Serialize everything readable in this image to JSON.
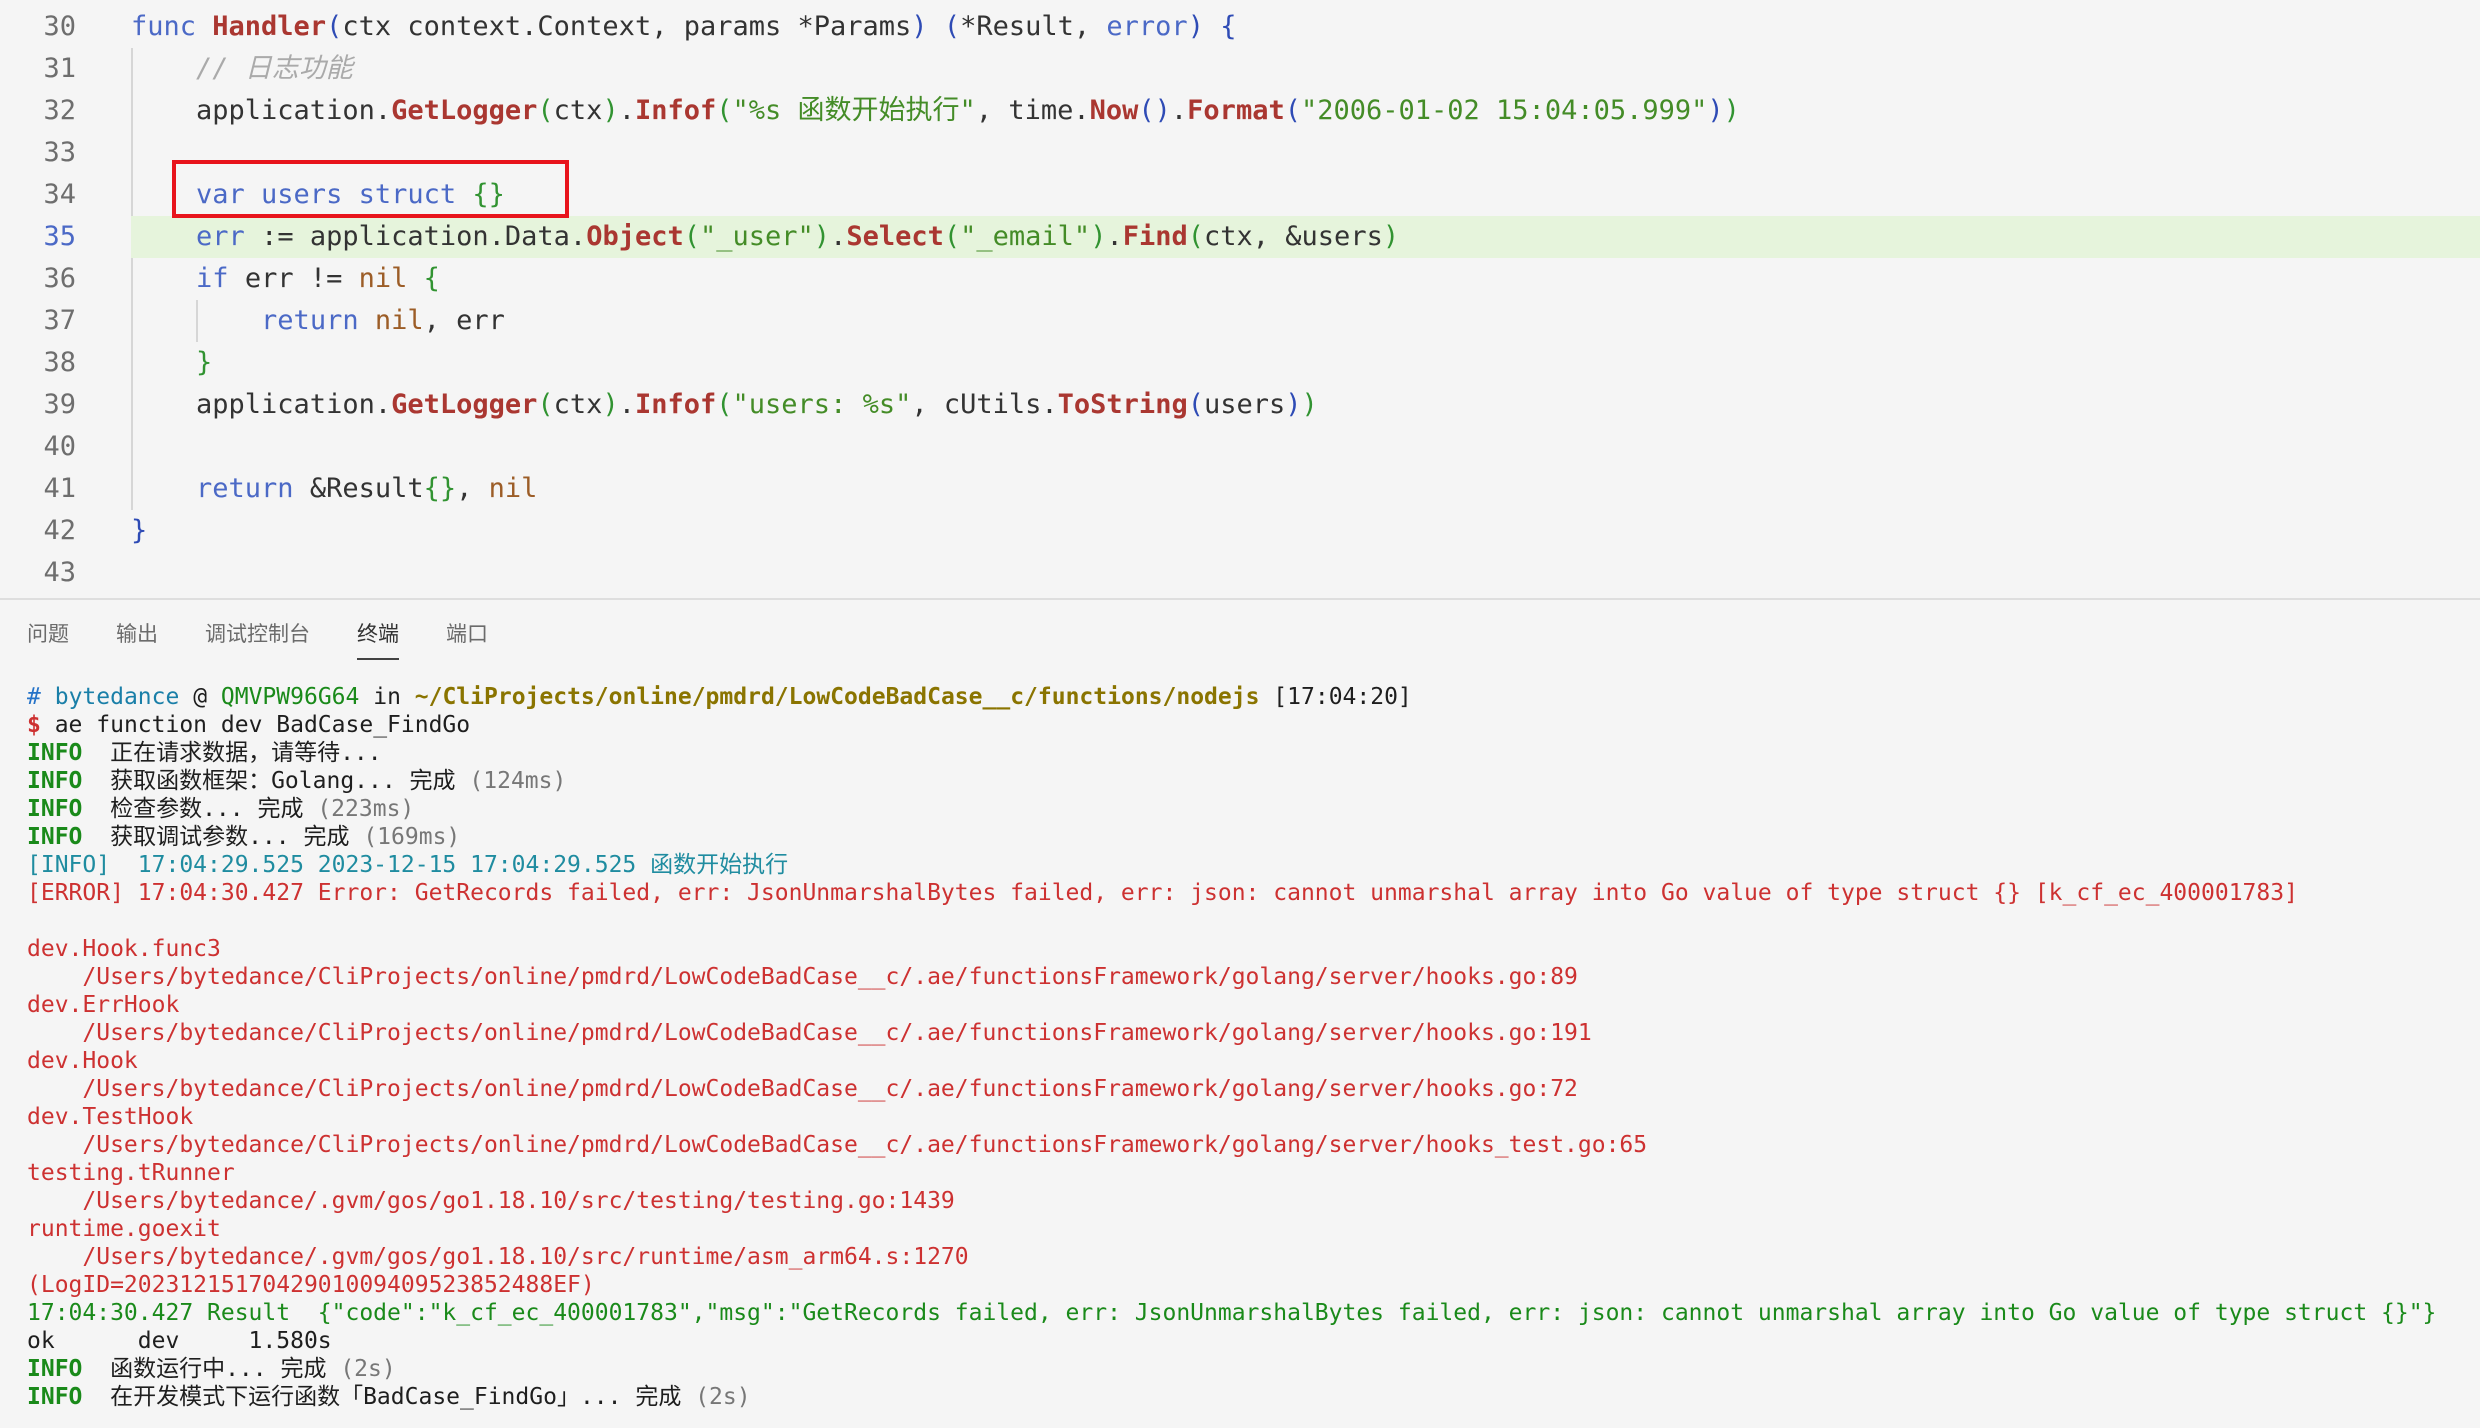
{
  "colors": {
    "background": "#f5f5f5",
    "current_line_bg": "#e6f4dc",
    "highlight_box": "#e8141c",
    "prompt_marker": "#1a85ff"
  },
  "editor": {
    "current_line": 35,
    "lines": [
      {
        "number": 30,
        "tokens": [
          {
            "t": "func ",
            "c": "#4b69c6"
          },
          {
            "t": "Handler",
            "c": "#aa3731"
          },
          {
            "t": "(",
            "c": "#2e4bb5"
          },
          {
            "t": "ctx context.Context, params *Params",
            "c": "#333333"
          },
          {
            "t": ")",
            "c": "#2e4bb5"
          },
          {
            "t": " ",
            "c": "#333333"
          },
          {
            "t": "(",
            "c": "#2e4bb5"
          },
          {
            "t": "*Result, ",
            "c": "#333333"
          },
          {
            "t": "error",
            "c": "#4b69c6"
          },
          {
            "t": ")",
            "c": "#2e4bb5"
          },
          {
            "t": " ",
            "c": "#333333"
          },
          {
            "t": "{",
            "c": "#2e4bb5"
          }
        ]
      },
      {
        "number": 31,
        "tokens": [
          {
            "t": "    // 日志功能",
            "c": "#aaaaaa"
          }
        ]
      },
      {
        "number": 32,
        "tokens": [
          {
            "t": "    application.",
            "c": "#333333"
          },
          {
            "t": "GetLogger",
            "c": "#aa3731"
          },
          {
            "t": "(",
            "c": "#319331"
          },
          {
            "t": "ctx",
            "c": "#333333"
          },
          {
            "t": ")",
            "c": "#319331"
          },
          {
            "t": ".",
            "c": "#333333"
          },
          {
            "t": "Infof",
            "c": "#aa3731"
          },
          {
            "t": "(",
            "c": "#319331"
          },
          {
            "t": "\"%s 函数开始执行\"",
            "c": "#448c27"
          },
          {
            "t": ", time.",
            "c": "#333333"
          },
          {
            "t": "Now",
            "c": "#aa3731"
          },
          {
            "t": "()",
            "c": "#2e4bb5"
          },
          {
            "t": ".",
            "c": "#333333"
          },
          {
            "t": "Format",
            "c": "#aa3731"
          },
          {
            "t": "(",
            "c": "#2e4bb5"
          },
          {
            "t": "\"2006-01-02 15:04:05.999\"",
            "c": "#448c27"
          },
          {
            "t": ")",
            "c": "#2e4bb5"
          },
          {
            "t": ")",
            "c": "#319331"
          }
        ]
      },
      {
        "number": 33,
        "tokens": []
      },
      {
        "number": 34,
        "tokens": [
          {
            "t": "    var users struct ",
            "c": "#4b69c6"
          },
          {
            "t": "{}",
            "c": "#319331"
          }
        ]
      },
      {
        "number": 35,
        "tokens": [
          {
            "t": "    ",
            "c": "#333333"
          },
          {
            "t": "err",
            "c": "#4b69c6"
          },
          {
            "t": " := application.Data.",
            "c": "#333333"
          },
          {
            "t": "Object",
            "c": "#aa3731"
          },
          {
            "t": "(",
            "c": "#319331"
          },
          {
            "t": "\"_user\"",
            "c": "#448c27"
          },
          {
            "t": ")",
            "c": "#319331"
          },
          {
            "t": ".",
            "c": "#333333"
          },
          {
            "t": "Select",
            "c": "#aa3731"
          },
          {
            "t": "(",
            "c": "#319331"
          },
          {
            "t": "\"_email\"",
            "c": "#448c27"
          },
          {
            "t": ")",
            "c": "#319331"
          },
          {
            "t": ".",
            "c": "#333333"
          },
          {
            "t": "Find",
            "c": "#aa3731"
          },
          {
            "t": "(",
            "c": "#319331"
          },
          {
            "t": "ctx, &users",
            "c": "#333333"
          },
          {
            "t": ")",
            "c": "#319331"
          }
        ]
      },
      {
        "number": 36,
        "tokens": [
          {
            "t": "    ",
            "c": "#333333"
          },
          {
            "t": "if ",
            "c": "#4b69c6"
          },
          {
            "t": "err != ",
            "c": "#333333"
          },
          {
            "t": "nil ",
            "c": "#9c5d27"
          },
          {
            "t": "{",
            "c": "#319331"
          }
        ]
      },
      {
        "number": 37,
        "tokens": [
          {
            "t": "        ",
            "c": "#333333"
          },
          {
            "t": "return ",
            "c": "#4b69c6"
          },
          {
            "t": "nil",
            "c": "#9c5d27"
          },
          {
            "t": ", err",
            "c": "#333333"
          }
        ]
      },
      {
        "number": 38,
        "tokens": [
          {
            "t": "    ",
            "c": "#333333"
          },
          {
            "t": "}",
            "c": "#319331"
          }
        ]
      },
      {
        "number": 39,
        "tokens": [
          {
            "t": "    application.",
            "c": "#333333"
          },
          {
            "t": "GetLogger",
            "c": "#aa3731"
          },
          {
            "t": "(",
            "c": "#319331"
          },
          {
            "t": "ctx",
            "c": "#333333"
          },
          {
            "t": ")",
            "c": "#319331"
          },
          {
            "t": ".",
            "c": "#333333"
          },
          {
            "t": "Infof",
            "c": "#aa3731"
          },
          {
            "t": "(",
            "c": "#319331"
          },
          {
            "t": "\"users: %s\"",
            "c": "#448c27"
          },
          {
            "t": ", cUtils.",
            "c": "#333333"
          },
          {
            "t": "ToString",
            "c": "#aa3731"
          },
          {
            "t": "(",
            "c": "#2e4bb5"
          },
          {
            "t": "users",
            "c": "#333333"
          },
          {
            "t": ")",
            "c": "#2e4bb5"
          },
          {
            "t": ")",
            "c": "#319331"
          }
        ]
      },
      {
        "number": 40,
        "tokens": []
      },
      {
        "number": 41,
        "tokens": [
          {
            "t": "    ",
            "c": "#333333"
          },
          {
            "t": "return ",
            "c": "#4b69c6"
          },
          {
            "t": "&Result",
            "c": "#333333"
          },
          {
            "t": "{}",
            "c": "#319331"
          },
          {
            "t": ", ",
            "c": "#333333"
          },
          {
            "t": "nil",
            "c": "#9c5d27"
          }
        ]
      },
      {
        "number": 42,
        "tokens": [
          {
            "t": "}",
            "c": "#2e4bb5"
          }
        ]
      },
      {
        "number": 43,
        "tokens": []
      }
    ]
  },
  "panel": {
    "tabs": [
      "问题",
      "输出",
      "调试控制台",
      "终端",
      "端口"
    ],
    "active_tab": "终端"
  },
  "terminal": {
    "lines": [
      {
        "segments": [
          {
            "t": "#",
            "c": "#2472c8"
          },
          {
            "t": " ",
            "c": "#1e1e1e"
          },
          {
            "t": "bytedance",
            "c": "#1a7fa8"
          },
          {
            "t": " @ ",
            "c": "#1e1e1e"
          },
          {
            "t": "QMVPW96G64",
            "c": "#1a8a1a"
          },
          {
            "t": " in ",
            "c": "#1e1e1e"
          },
          {
            "t": "~/CliProjects/online/pmdrd/LowCodeBadCase__c/functions/nodejs",
            "c": "#8a7400",
            "b": true
          },
          {
            "t": " [17:04:20]",
            "c": "#1e1e1e"
          }
        ]
      },
      {
        "marker": true,
        "segments": [
          {
            "t": "$",
            "c": "#cd3131",
            "b": true
          },
          {
            "t": " ae function dev BadCase_FindGo",
            "c": "#1e1e1e"
          }
        ]
      },
      {
        "segments": [
          {
            "t": "INFO",
            "c": "#1a8a1a",
            "b": true
          },
          {
            "t": "  正在请求数据，请等待...",
            "c": "#1e1e1e"
          }
        ]
      },
      {
        "segments": [
          {
            "t": "INFO",
            "c": "#1a8a1a",
            "b": true
          },
          {
            "t": "  获取函数框架：Golang... 完成 ",
            "c": "#1e1e1e"
          },
          {
            "t": "(124ms)",
            "c": "#777777"
          }
        ]
      },
      {
        "segments": [
          {
            "t": "INFO",
            "c": "#1a8a1a",
            "b": true
          },
          {
            "t": "  检查参数... 完成 ",
            "c": "#1e1e1e"
          },
          {
            "t": "(223ms)",
            "c": "#777777"
          }
        ]
      },
      {
        "segments": [
          {
            "t": "INFO",
            "c": "#1a8a1a",
            "b": true
          },
          {
            "t": "  获取调试参数... 完成 ",
            "c": "#1e1e1e"
          },
          {
            "t": "(169ms)",
            "c": "#777777"
          }
        ]
      },
      {
        "segments": [
          {
            "t": "[INFO]  17:04:29.525 2023-12-15 17:04:29.525 函数开始执行",
            "c": "#1f8ca0"
          }
        ]
      },
      {
        "segments": [
          {
            "t": "[ERROR] 17:04:30.427 Error: GetRecords failed, err: JsonUnmarshalBytes failed, err: json: cannot unmarshal array into Go value of type struct {} [k_cf_ec_400001783]",
            "c": "#cd3131"
          }
        ]
      },
      {
        "segments": []
      },
      {
        "segments": [
          {
            "t": "dev.Hook.func3",
            "c": "#cd3131"
          }
        ]
      },
      {
        "segments": [
          {
            "t": "    /Users/bytedance/CliProjects/online/pmdrd/LowCodeBadCase__c/.ae/functionsFramework/golang/server/hooks.go:89",
            "c": "#cd3131"
          }
        ]
      },
      {
        "segments": [
          {
            "t": "dev.ErrHook",
            "c": "#cd3131"
          }
        ]
      },
      {
        "segments": [
          {
            "t": "    /Users/bytedance/CliProjects/online/pmdrd/LowCodeBadCase__c/.ae/functionsFramework/golang/server/hooks.go:191",
            "c": "#cd3131"
          }
        ]
      },
      {
        "segments": [
          {
            "t": "dev.Hook",
            "c": "#cd3131"
          }
        ]
      },
      {
        "segments": [
          {
            "t": "    /Users/bytedance/CliProjects/online/pmdrd/LowCodeBadCase__c/.ae/functionsFramework/golang/server/hooks.go:72",
            "c": "#cd3131"
          }
        ]
      },
      {
        "segments": [
          {
            "t": "dev.TestHook",
            "c": "#cd3131"
          }
        ]
      },
      {
        "segments": [
          {
            "t": "    /Users/bytedance/CliProjects/online/pmdrd/LowCodeBadCase__c/.ae/functionsFramework/golang/server/hooks_test.go:65",
            "c": "#cd3131"
          }
        ]
      },
      {
        "segments": [
          {
            "t": "testing.tRunner",
            "c": "#cd3131"
          }
        ]
      },
      {
        "segments": [
          {
            "t": "    /Users/bytedance/.gvm/gos/go1.18.10/src/testing/testing.go:1439",
            "c": "#cd3131"
          }
        ]
      },
      {
        "segments": [
          {
            "t": "runtime.goexit",
            "c": "#cd3131"
          }
        ]
      },
      {
        "segments": [
          {
            "t": "    /Users/bytedance/.gvm/gos/go1.18.10/src/runtime/asm_arm64.s:1270",
            "c": "#cd3131"
          }
        ]
      },
      {
        "segments": [
          {
            "t": "(LogID=2023121517042901009409523852488EF)",
            "c": "#cd3131"
          }
        ]
      },
      {
        "segments": [
          {
            "t": "17:04:30.427 Result  {\"code\":\"k_cf_ec_400001783\",\"msg\":\"GetRecords failed, err: JsonUnmarshalBytes failed, err: json: cannot unmarshal array into Go value of type struct {}\"}",
            "c": "#1a8a1a"
          }
        ]
      },
      {
        "segments": [
          {
            "t": "ok      dev     1.580s",
            "c": "#1e1e1e"
          }
        ]
      },
      {
        "segments": [
          {
            "t": "INFO",
            "c": "#1a8a1a",
            "b": true
          },
          {
            "t": "  函数运行中... 完成 ",
            "c": "#1e1e1e"
          },
          {
            "t": "(2s)",
            "c": "#777777"
          }
        ]
      },
      {
        "segments": [
          {
            "t": "INFO",
            "c": "#1a8a1a",
            "b": true
          },
          {
            "t": "  在开发模式下运行函数「BadCase_FindGo」... 完成 ",
            "c": "#1e1e1e"
          },
          {
            "t": "(2s)",
            "c": "#777777"
          }
        ]
      }
    ]
  }
}
